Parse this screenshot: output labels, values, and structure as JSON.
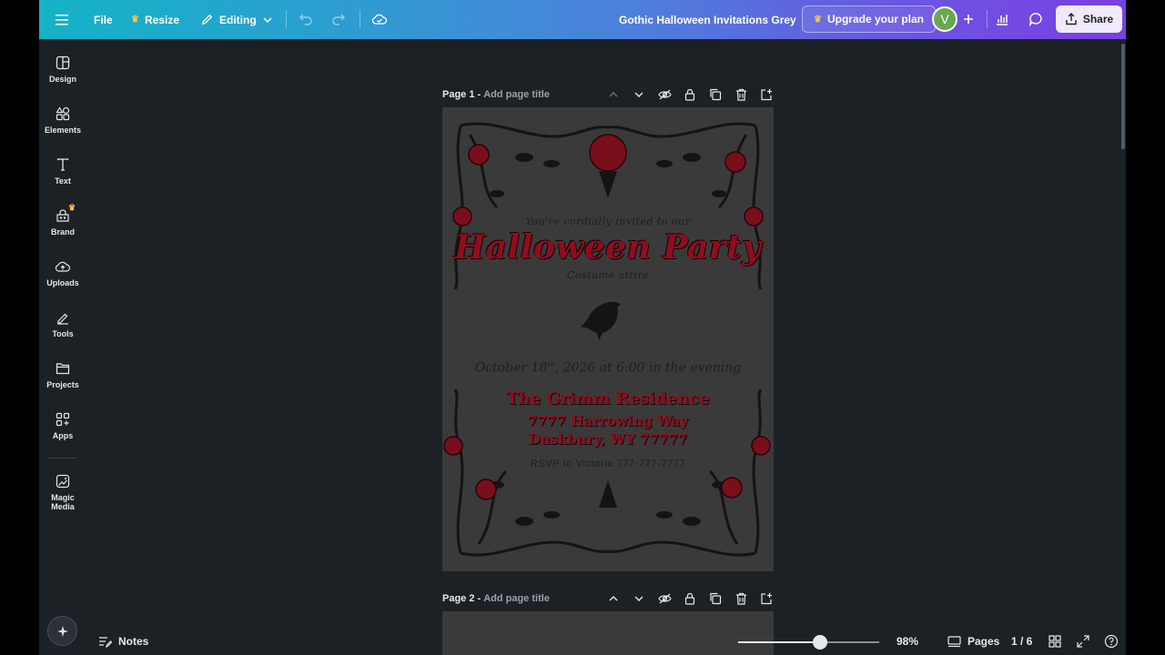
{
  "topbar": {
    "menu_icon": "hamburger-menu-icon",
    "file_label": "File",
    "resize_label": "Resize",
    "editing_label": "Editing",
    "doc_title": "Gothic Halloween Invitations Grey",
    "upgrade_label": "Upgrade your plan",
    "avatar_initial": "V",
    "share_label": "Share"
  },
  "sidebar": {
    "items": [
      {
        "label": "Design",
        "icon": "design-icon"
      },
      {
        "label": "Elements",
        "icon": "elements-icon"
      },
      {
        "label": "Text",
        "icon": "text-icon"
      },
      {
        "label": "Brand",
        "icon": "brand-icon"
      },
      {
        "label": "Uploads",
        "icon": "uploads-icon"
      },
      {
        "label": "Tools",
        "icon": "tools-icon"
      },
      {
        "label": "Projects",
        "icon": "projects-icon"
      },
      {
        "label": "Apps",
        "icon": "apps-icon"
      },
      {
        "label": "Magic Media",
        "icon": "magic-media-icon"
      }
    ]
  },
  "pages": [
    {
      "title": "Page 1 -",
      "placeholder": "Add page title"
    },
    {
      "title": "Page 2 -",
      "placeholder": "Add page title"
    }
  ],
  "invitation": {
    "invited": "You're cordially invited to our",
    "party": "Halloween Party",
    "attire": "Costume attire",
    "date_prefix": "October 18",
    "date_sup": "th",
    "date_suffix": ", 2026 at 6:00 in the evening",
    "residence": "The Grimm Residence",
    "address1": "7777 Harrowing Way",
    "address2": "Duskbury, WY 77777",
    "rsvp": "RSVP to Victoria 777-777-7777"
  },
  "bottombar": {
    "notes_label": "Notes",
    "zoom_label": "98%",
    "zoom_value": 0.58,
    "pages_label": "Pages",
    "page_count": "1 / 6"
  },
  "colors": {
    "accent_red": "#8f0d1e",
    "canvas_bg": "#1c2126",
    "page_bg": "#3a3a3a"
  }
}
